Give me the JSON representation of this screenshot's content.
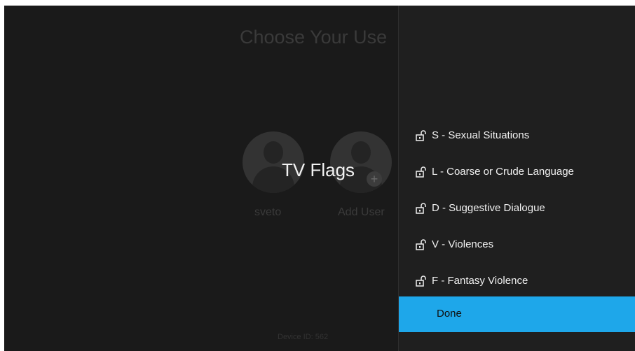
{
  "background": {
    "title": "Choose Your Use",
    "users": [
      {
        "label": "sveto"
      },
      {
        "label": "Add User"
      }
    ],
    "device_id": "Device ID: 562"
  },
  "panel": {
    "heading": "TV Flags",
    "items": [
      {
        "label": "S - Sexual Situations",
        "icon": "unlock-icon"
      },
      {
        "label": "L - Coarse or Crude Language",
        "icon": "unlock-icon"
      },
      {
        "label": "D - Suggestive Dialogue",
        "icon": "unlock-icon"
      },
      {
        "label": "V - Violences",
        "icon": "unlock-icon"
      },
      {
        "label": "F - Fantasy Violence",
        "icon": "unlock-icon"
      }
    ],
    "done_label": "Done"
  },
  "colors": {
    "accent": "#1ea7ea",
    "background": "#1c1c1c",
    "panel": "#1f1f1f"
  }
}
